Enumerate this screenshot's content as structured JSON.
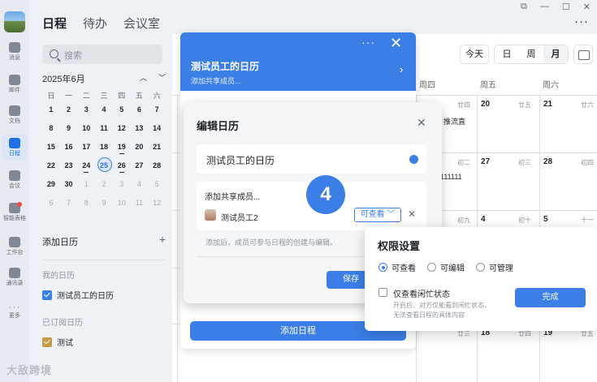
{
  "header": {
    "tabs": [
      "日程",
      "待办",
      "会议室"
    ],
    "window_controls": [
      "⧉",
      "—",
      "☐",
      "✕"
    ],
    "more": "···"
  },
  "rail": {
    "items": [
      {
        "label": "消息",
        "icon": "message-icon"
      },
      {
        "label": "邮件",
        "icon": "mail-icon"
      },
      {
        "label": "文档",
        "icon": "docs-icon"
      },
      {
        "label": "日程",
        "icon": "calendar-icon",
        "active": true
      },
      {
        "label": "会议",
        "icon": "meeting-icon"
      },
      {
        "label": "智能表格",
        "icon": "smart-sheet-icon",
        "badge": true
      },
      {
        "label": "工作台",
        "icon": "workbench-icon"
      },
      {
        "label": "通讯录",
        "icon": "contacts-icon"
      },
      {
        "label": "更多",
        "icon": "more-icon"
      }
    ]
  },
  "sidebar": {
    "search_placeholder": "搜索",
    "mini_cal": {
      "month_label": "2025年6月",
      "nav_up": "︿",
      "nav_down": "﹀",
      "weekdays": [
        "日",
        "一",
        "二",
        "三",
        "四",
        "五",
        "六"
      ],
      "weeks": [
        [
          "1",
          "2",
          "3",
          "4",
          "5",
          "6",
          "7"
        ],
        [
          "8",
          "9",
          "10",
          "11",
          "12",
          "13",
          "14"
        ],
        [
          "15",
          "16",
          "17",
          "18",
          "19",
          "20",
          "21"
        ],
        [
          "22",
          "23",
          "24",
          "25",
          "26",
          "27",
          "28"
        ],
        [
          "29",
          "30",
          "1",
          "2",
          "3",
          "4",
          "5"
        ],
        [
          "6",
          "7",
          "8",
          "9",
          "10",
          "11",
          "12"
        ]
      ],
      "today": "25"
    },
    "add_calendar": "添加日历",
    "add_icon": "+",
    "my_calendars_title": "我的日历",
    "my_calendars": [
      "测试员工的日历"
    ],
    "subscribed_title": "已订阅日历",
    "subscribed": [
      "测试"
    ]
  },
  "watermark": "大敌跨境",
  "toolbar": {
    "today": "今天",
    "views": [
      "日",
      "周",
      "月"
    ],
    "active_view": "月"
  },
  "calendar": {
    "col_headers": [
      "周四",
      "周五",
      "周六"
    ],
    "cells": [
      {
        "n": "",
        "l": "廿四"
      },
      {
        "n": "20",
        "l": "廿五"
      },
      {
        "n": "21",
        "l": "廿六"
      },
      {
        "n": "",
        "l": "初二"
      },
      {
        "n": "27",
        "l": "初三"
      },
      {
        "n": "28",
        "l": "初四"
      },
      {
        "n": "",
        "l": "初九"
      },
      {
        "n": "4",
        "l": "初十"
      },
      {
        "n": "5",
        "l": "十一"
      },
      {
        "n": "",
        "l": "十六"
      },
      {
        "n": "11",
        "l": "十七"
      },
      {
        "n": "12",
        "l": "十八"
      },
      {
        "n": "",
        "l": "廿三"
      },
      {
        "n": "18",
        "l": "廿四"
      },
      {
        "n": "19",
        "l": "廿五"
      }
    ],
    "events": [
      "推流直",
      "111111"
    ]
  },
  "blue_panel": {
    "title": "测试员工的日历",
    "subtitle": "添加共享成员...",
    "dots": "···",
    "close": "✕",
    "arrow": "›",
    "add_event": "添加日程"
  },
  "edit_dialog": {
    "title": "编辑日历",
    "close": "✕",
    "calendar_name": "测试员工的日历",
    "share_placeholder": "添加共享成员...",
    "member_name": "测试员工2",
    "member_permission": "可查看 ﹀",
    "remove": "✕",
    "hint": "添加后，成员可参与日程的创建与编辑。",
    "save": "保存"
  },
  "step_badge": "4",
  "permission_popover": {
    "title": "权限设置",
    "options": [
      "可查看",
      "可编辑",
      "可管理"
    ],
    "selected": "可查看",
    "busy_only_label": "仅查看闲忙状态",
    "busy_only_desc": "开启后，对方仅能看到闲忙状态，\n无法查看日程的具体内容",
    "done": "完成"
  }
}
